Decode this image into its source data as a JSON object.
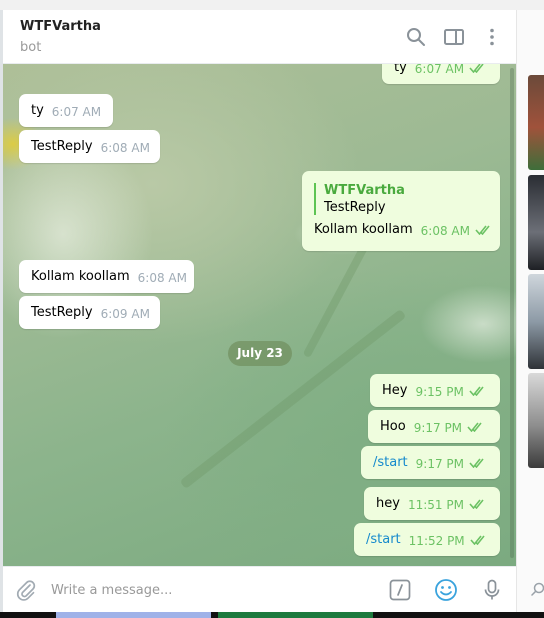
{
  "header": {
    "title": "WTFVartha",
    "subtitle": "bot",
    "icons": [
      "search-icon",
      "sidebar-toggle-icon",
      "more-vertical-icon"
    ]
  },
  "messages": [
    {
      "direction": "out",
      "text": "ty",
      "time": "6:07 AM",
      "status": "read"
    },
    {
      "direction": "in",
      "text": "ty",
      "time": "6:07 AM"
    },
    {
      "direction": "in",
      "text": "TestReply",
      "time": "6:08 AM"
    },
    {
      "direction": "out",
      "reply_to_author": "WTFVartha",
      "reply_to_text": "TestReply",
      "text": "Kollam koollam",
      "time": "6:08 AM",
      "status": "read"
    },
    {
      "direction": "in",
      "text": "Kollam koollam",
      "time": "6:08 AM"
    },
    {
      "direction": "in",
      "text": "TestReply",
      "time": "6:09 AM"
    },
    {
      "direction": "out",
      "text": "Hey",
      "time": "9:15 PM",
      "status": "read"
    },
    {
      "direction": "out",
      "text": "Hoo",
      "time": "9:17 PM",
      "status": "read"
    },
    {
      "direction": "out",
      "text": "/start",
      "time": "9:17 PM",
      "status": "read"
    },
    {
      "direction": "out",
      "text": "hey",
      "time": "11:51 PM",
      "status": "read"
    },
    {
      "direction": "out",
      "text": "/start",
      "time": "11:52 PM",
      "status": "read"
    }
  ],
  "date_separator": "July 23",
  "composer": {
    "placeholder": "Write a message...",
    "icons": [
      "attach-icon",
      "commands-icon",
      "emoji-icon",
      "microphone-icon"
    ]
  },
  "colors": {
    "outgoing_bubble": "#effdde",
    "incoming_bubble": "#ffffff",
    "outgoing_time": "#6cc264",
    "command_link": "#168acd",
    "reply_author": "#4aaa3e"
  }
}
